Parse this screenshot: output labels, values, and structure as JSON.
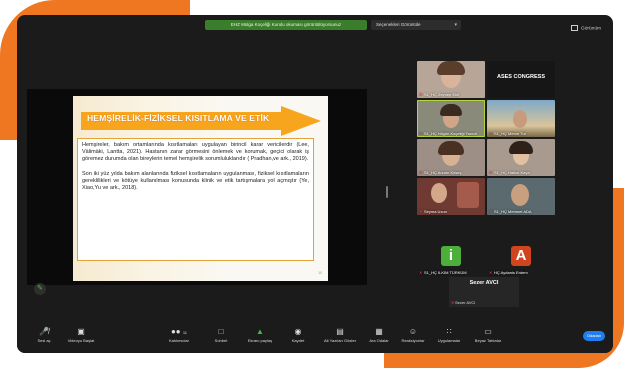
{
  "meeting": {
    "banner_text": "EHZ Mülga Koçeliği Kurulu okuması görüntülüyorsunuz",
    "view_button_label": "Seçenekleri Görüntüle",
    "fullscreen_label": "Görünüm"
  },
  "slide": {
    "title": "HEMŞİRELİK-FİZİKSEL KISITLAMA VE ETİK",
    "paragraph1": "Hemşireler, bakım ortamlarında kısıtlamaları uygulayan birincil karar vericilerdir (Lee, Välimäki, Lantta, 2021). Hastanın zarar görmesini önlemek ve korumak, geçici olarak iş göremez durumda olan bireylerin temel hemşirelik sorumluluklarıdır ( Pradhan,ve ark., 2019).",
    "paragraph2": "Son iki yüz yılda bakım alanlarında fiziksel kısıtlamaların uygulanması, fiziksel kısıtlamaların gereklilikleri ve kötüye kullanılması konusunda klinik ve etik tartışmalara yol açmıştır (Ye, Xiao,Yu ve ark., 2018).",
    "page_number": "10"
  },
  "participants": [
    {
      "name": "S1_HÇ Zeynep Ekli",
      "kind": "video"
    },
    {
      "name": "ASES CONGRESS",
      "kind": "text"
    },
    {
      "name": "S1_HÇ Nilgün Koçeliği Yoredi",
      "kind": "video",
      "active": true
    },
    {
      "name": "S1_HÇ Merve Tur",
      "kind": "video"
    },
    {
      "name": "S1_HÇ Arzum Köseç",
      "kind": "video"
    },
    {
      "name": "S1_HÇ Hatice Kaya",
      "kind": "video"
    },
    {
      "name": "Seyma Uzun",
      "kind": "video"
    },
    {
      "name": "S1_HÇ Mehmet ADA",
      "kind": "video"
    },
    {
      "name": "S1_HÇ ILKIM TÜRKÜM",
      "kind": "initial",
      "initial": "i",
      "color": "#4caf3a"
    },
    {
      "name": "HÇ Aydanis Erdem",
      "kind": "initial",
      "initial": "A",
      "color": "#d0451f"
    }
  ],
  "self_view": {
    "name": "Sezer AVCI",
    "sub_label": "Sezer AVCI"
  },
  "toolbar": {
    "mute_label": "Sesi aç",
    "video_label": "Videoyu Başlat",
    "participants_label": "Katılımcılar",
    "participants_count": "11",
    "chat_label": "Sohbet",
    "share_label": "Ekranı paylaş",
    "record_label": "Kaydet",
    "captions_label": "Alt Yazıları Göster",
    "breakout_label": "Ara Odalar",
    "reactions_label": "Reaksiyonlar",
    "apps_label": "Uygulamalar",
    "whiteboard_label": "Beyaz Tahtalar",
    "leave_label": "Odadan"
  },
  "colors": {
    "orange_frame": "#ef7722",
    "screen_bg": "#1b1b1b",
    "active_speaker": "#b4d53a",
    "slide_arrow": "#f7a51c",
    "banner_green": "#3a7d2a"
  }
}
